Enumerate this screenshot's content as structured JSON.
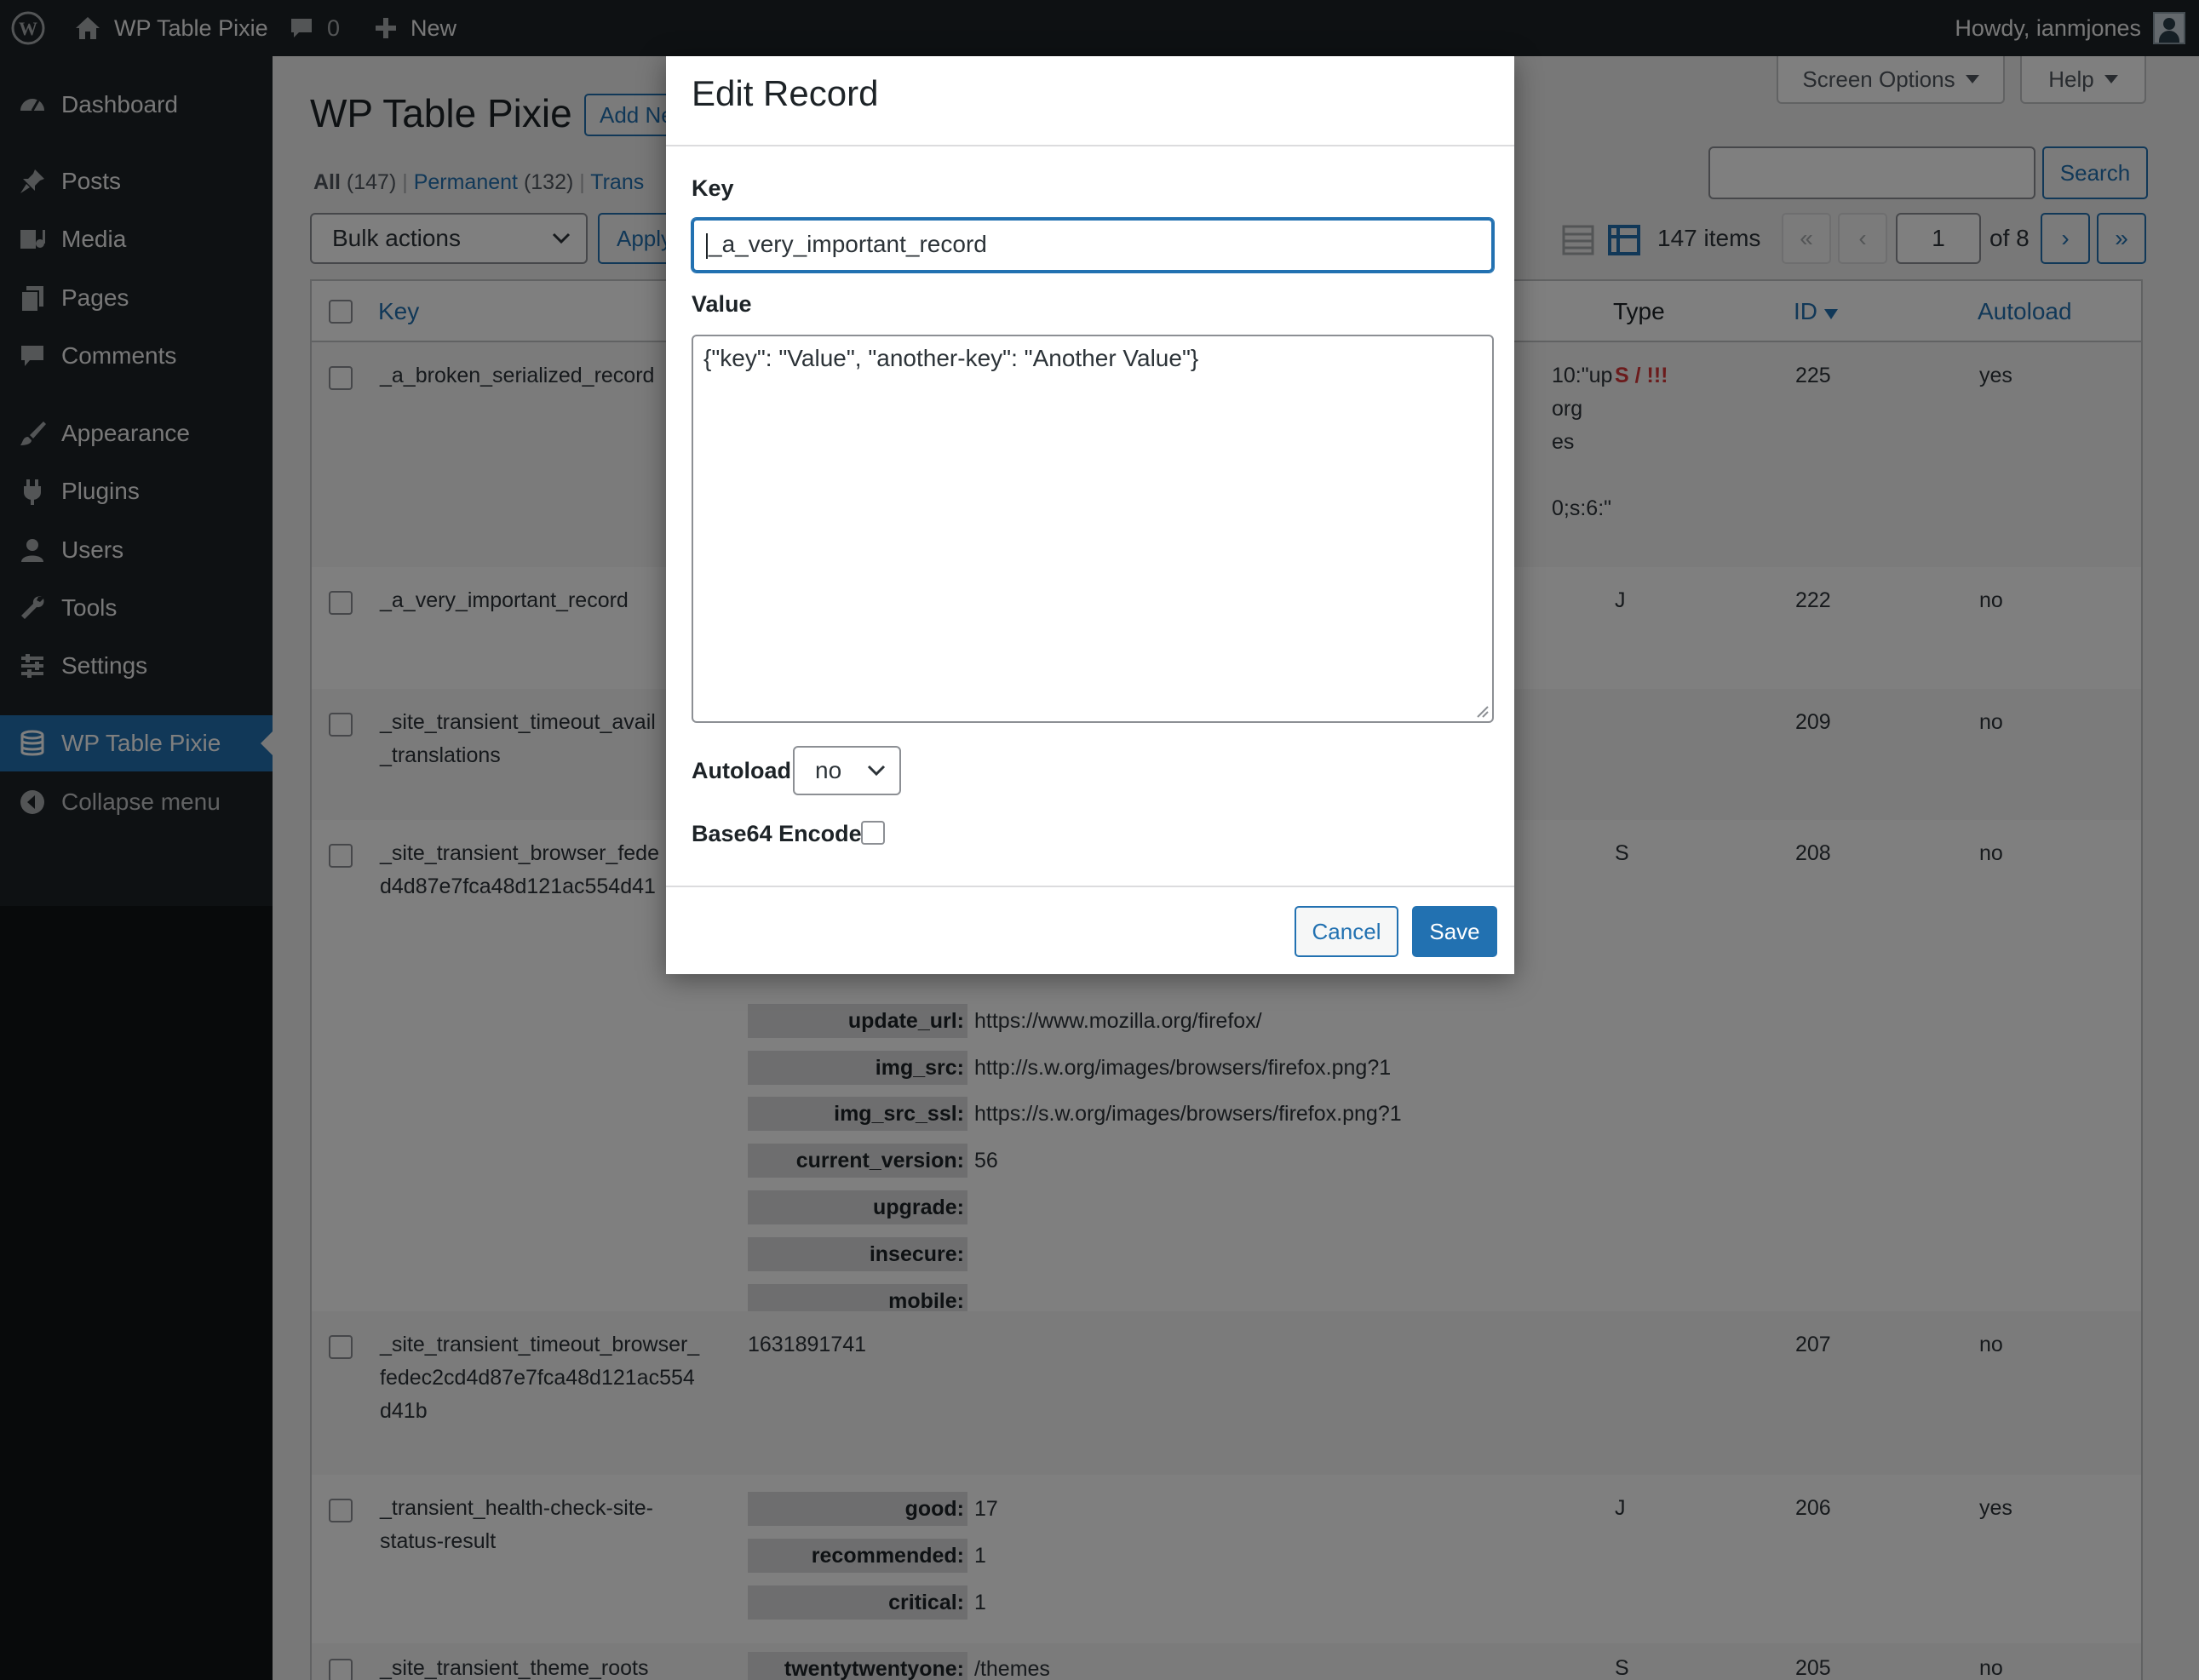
{
  "adminbar": {
    "site_name": "WP Table Pixie",
    "comments_count": "0",
    "new_label": "New",
    "howdy": "Howdy, ianmjones"
  },
  "sidebar": {
    "items": [
      {
        "label": "Dashboard",
        "icon": "dashboard-icon"
      },
      {
        "label": "Posts",
        "icon": "pin-icon"
      },
      {
        "label": "Media",
        "icon": "media-icon"
      },
      {
        "label": "Pages",
        "icon": "pages-icon"
      },
      {
        "label": "Comments",
        "icon": "comments-icon"
      },
      {
        "label": "Appearance",
        "icon": "brush-icon"
      },
      {
        "label": "Plugins",
        "icon": "plugin-icon"
      },
      {
        "label": "Users",
        "icon": "users-icon"
      },
      {
        "label": "Tools",
        "icon": "wrench-icon"
      },
      {
        "label": "Settings",
        "icon": "settings-icon"
      },
      {
        "label": "WP Table Pixie",
        "icon": "database-icon"
      },
      {
        "label": "Collapse menu",
        "icon": "collapse-icon"
      }
    ]
  },
  "page": {
    "title": "WP Table Pixie",
    "add_new": "Add New",
    "screen_options": "Screen Options",
    "help": "Help",
    "filters": {
      "all": "All",
      "all_count": "(147)",
      "permanent": "Permanent",
      "permanent_count": "(132)",
      "transient": "Trans"
    },
    "bulk_actions": "Bulk actions",
    "apply": "Apply",
    "search_button": "Search",
    "search_value": "",
    "items_count": "147 items",
    "pager": {
      "first": "«",
      "prev": "‹",
      "current": "1",
      "of": "of 8",
      "next": "›",
      "last": "»"
    }
  },
  "table": {
    "columns": {
      "key": "Key",
      "type": "Type",
      "id": "ID",
      "autoload": "Autoload"
    },
    "rows": [
      {
        "key": "_a_broken_serialized_record",
        "type": "S / !!!",
        "id": "225",
        "autoload": "yes",
        "value_fragments": [
          "10:\"up",
          "org",
          "es",
          "0;s:6:\""
        ]
      },
      {
        "key": "_a_very_important_record",
        "type": "J",
        "id": "222",
        "autoload": "no"
      },
      {
        "key_line1": "_site_transient_timeout_avail",
        "key_line2": "_translations",
        "type": "",
        "id": "209",
        "autoload": "no"
      },
      {
        "key_line1": "_site_transient_browser_fede",
        "key_line2": "d4d87e7fca48d121ac554d41",
        "type": "S",
        "id": "208",
        "autoload": "no",
        "pairs": [
          {
            "k": "update_url:",
            "v": "https://www.mozilla.org/firefox/"
          },
          {
            "k": "img_src:",
            "v": "http://s.w.org/images/browsers/firefox.png?1"
          },
          {
            "k": "img_src_ssl:",
            "v": "https://s.w.org/images/browsers/firefox.png?1"
          },
          {
            "k": "current_version:",
            "v": "56"
          },
          {
            "k": "upgrade:",
            "v": ""
          },
          {
            "k": "insecure:",
            "v": ""
          },
          {
            "k": "mobile:",
            "v": ""
          }
        ]
      },
      {
        "key_line1": "_site_transient_timeout_browser_",
        "key_line2": "fedec2cd4d87e7fca48d121ac554",
        "key_line3": "d41b",
        "value": "1631891741",
        "type": "",
        "id": "207",
        "autoload": "no"
      },
      {
        "key_line1": "_transient_health-check-site-",
        "key_line2": "status-result",
        "type": "J",
        "id": "206",
        "autoload": "yes",
        "pairs": [
          {
            "k": "good:",
            "v": "17"
          },
          {
            "k": "recommended:",
            "v": "1"
          },
          {
            "k": "critical:",
            "v": "1"
          }
        ]
      },
      {
        "key": "_site_transient_theme_roots",
        "type": "S",
        "id": "205",
        "autoload": "no",
        "pairs": [
          {
            "k": "twentytwentyone:",
            "v": "/themes"
          }
        ]
      }
    ]
  },
  "modal": {
    "title": "Edit Record",
    "key_label": "Key",
    "key_value": "_a_very_important_record",
    "value_label": "Value",
    "value_text": "{\"key\": \"Value\", \"another-key\": \"Another Value\"}",
    "autoload_label": "Autoload",
    "autoload_value": "no",
    "base64_label": "Base64 Encode",
    "cancel": "Cancel",
    "save": "Save"
  },
  "colors": {
    "accent": "#2271b1",
    "sidebar_bg": "#1d2327",
    "error": "#d63638"
  }
}
